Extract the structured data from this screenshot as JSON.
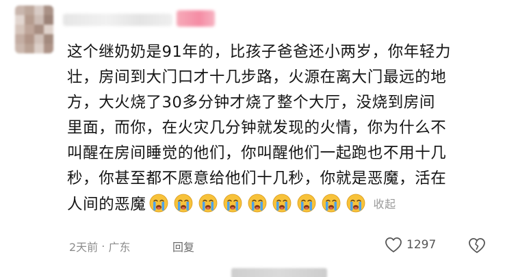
{
  "comment": {
    "lines": [
      "这个继奶奶是91年的，比孩子爸爸还小两岁，你年轻力",
      "壮，房间到大门口才十几步路，火源在离大门最远的地",
      "方，大火烧了30多分钟才烧了整个大厅，没烧到房间",
      "里面，而你，在火灾几分钟就发现的火情，你为什么不",
      "叫醒在房间睡觉的他们，你叫醒他们一起跑也不用十几",
      "秒，你甚至都不愿意给他们十几秒，你就是恶魔，活在",
      "人间的恶魔"
    ],
    "emoji_icon": "crying-face-emoji",
    "emoji_count": 9,
    "collapse_label": "收起"
  },
  "meta": {
    "time": "2天前",
    "separator": "·",
    "location": "广东",
    "reply_label": "回复"
  },
  "actions": {
    "like_icon": "heart-outline-icon",
    "like_count": "1297",
    "dislike_icon": "broken-heart-icon"
  },
  "colors": {
    "text": "#151515",
    "muted": "#8c8c8c",
    "emoji_face": "#f7c23a",
    "emoji_tears": "#4fa3e8",
    "badge": "#f58ca4"
  }
}
